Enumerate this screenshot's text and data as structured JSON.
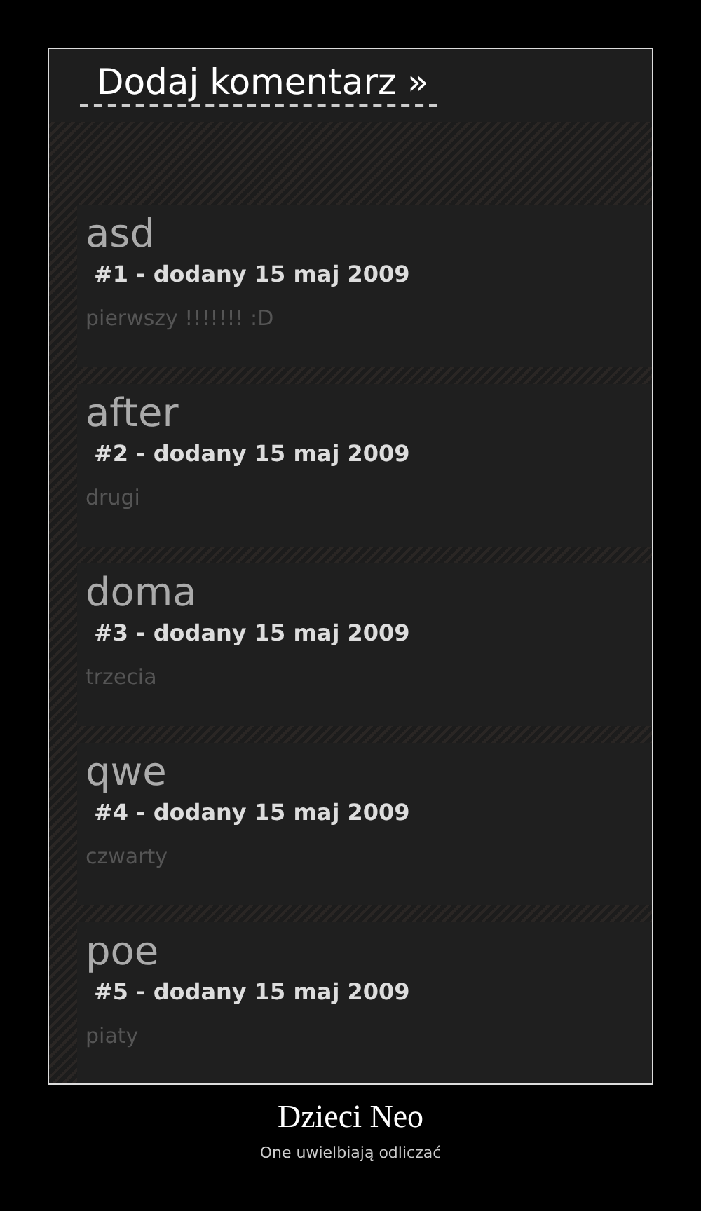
{
  "header": {
    "link": "Dodaj komentarz »"
  },
  "comments": [
    {
      "author": "asd",
      "meta": "**#1** - dodany 15 maj 2009",
      "body": "pierwszy !!!!!!! :D"
    },
    {
      "author": "after",
      "meta": "**#2** - dodany 15 maj 2009",
      "body": "drugi"
    },
    {
      "author": "doma",
      "meta": "**#3** - dodany 15 maj 2009",
      "body": "trzecia"
    },
    {
      "author": "qwe",
      "meta": "**#4** - dodany 15 maj 2009",
      "body": "czwarty"
    },
    {
      "author": "poe",
      "meta": "**#5** - dodany 15 maj 2009",
      "body": "piaty"
    }
  ],
  "poster": {
    "title": "Dzieci Neo",
    "caption": "One uwielbiają odliczać"
  }
}
